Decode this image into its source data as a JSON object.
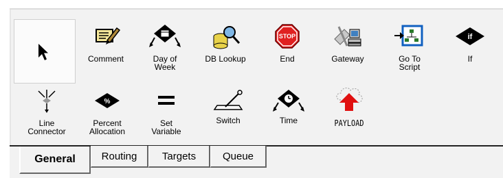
{
  "tools": [
    {
      "id": "pointer",
      "label": "",
      "icon": "arrow-pointer-icon"
    },
    {
      "id": "comment",
      "label": "Comment",
      "icon": "comment-icon"
    },
    {
      "id": "day-of-week",
      "label": "Day of\nWeek",
      "icon": "day-of-week-icon"
    },
    {
      "id": "db-lookup",
      "label": "DB Lookup",
      "icon": "database-lookup-icon"
    },
    {
      "id": "end",
      "label": "End",
      "icon": "stop-sign-icon"
    },
    {
      "id": "gateway",
      "label": "Gateway",
      "icon": "gateway-icon"
    },
    {
      "id": "go-to-script",
      "label": "Go To\nScript",
      "icon": "go-to-script-icon"
    },
    {
      "id": "if",
      "label": "If",
      "icon": "if-diamond-icon"
    },
    {
      "id": "line-connector",
      "label": "Line\nConnector",
      "icon": "line-connector-icon"
    },
    {
      "id": "percent-allocation",
      "label": "Percent\nAllocation",
      "icon": "percent-diamond-icon"
    },
    {
      "id": "set-variable",
      "label": "Set\nVariable",
      "icon": "equals-icon"
    },
    {
      "id": "switch",
      "label": "Switch",
      "icon": "switch-icon"
    },
    {
      "id": "time",
      "label": "Time",
      "icon": "clock-diamond-icon"
    },
    {
      "id": "payload",
      "label": "PAYLOAD",
      "icon": "payload-upload-icon"
    }
  ],
  "tabs": [
    {
      "label": "General",
      "active": true
    },
    {
      "label": "Routing",
      "active": false
    },
    {
      "label": "Targets",
      "active": false
    },
    {
      "label": "Queue",
      "active": false
    }
  ],
  "colors": {
    "palette_bg": "#f2f2f2",
    "stop_red": "#e02020",
    "accent_blue": "#1060c0",
    "arrow_red": "#e01010"
  }
}
